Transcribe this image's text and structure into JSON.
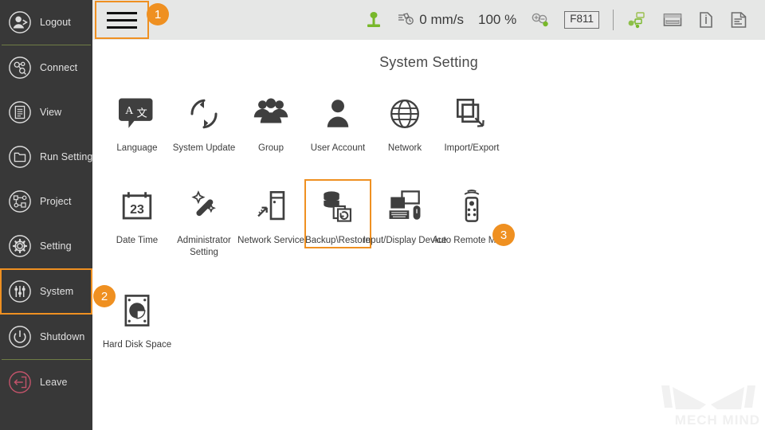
{
  "sidebar": {
    "items": [
      {
        "label": "Logout",
        "icon": "logout-user-icon",
        "sep_after": true,
        "highlight": false
      },
      {
        "label": "Connect",
        "icon": "connect-icon",
        "sep_after": false,
        "highlight": false
      },
      {
        "label": "View",
        "icon": "view-list-icon",
        "sep_after": false,
        "highlight": false
      },
      {
        "label": "Run Setting",
        "icon": "run-setting-icon",
        "sep_after": false,
        "highlight": false
      },
      {
        "label": "Project",
        "icon": "project-node-icon",
        "sep_after": false,
        "highlight": false
      },
      {
        "label": "Setting",
        "icon": "gear-icon",
        "sep_after": false,
        "highlight": false
      },
      {
        "label": "System",
        "icon": "sliders-icon",
        "sep_after": false,
        "highlight": true
      },
      {
        "label": "Shutdown",
        "icon": "power-icon",
        "sep_after": true,
        "highlight": false
      },
      {
        "label": "Leave",
        "icon": "leave-exit-icon",
        "sep_after": false,
        "highlight": false
      }
    ]
  },
  "topbar": {
    "menu_button": {
      "name": "hamburger-menu-button",
      "highlighted": true
    },
    "items": [
      {
        "type": "icon",
        "name": "robot-jog-icon",
        "text": ""
      },
      {
        "type": "text",
        "name": "speed-indicator",
        "text": "0 mm/s",
        "icon": "speed-icon"
      },
      {
        "type": "text",
        "name": "override-indicator",
        "text": "100 %"
      },
      {
        "type": "icon",
        "name": "zoom-plus-minus-icon",
        "text": ""
      },
      {
        "type": "box",
        "name": "frame-indicator",
        "text": "F811"
      },
      {
        "type": "divider",
        "name": "toolbar-divider",
        "text": ""
      },
      {
        "type": "icon",
        "name": "network-status-icon",
        "text": ""
      },
      {
        "type": "icon",
        "name": "keyboard-icon",
        "text": ""
      },
      {
        "type": "icon",
        "name": "info-icon",
        "text": ""
      },
      {
        "type": "icon",
        "name": "log-document-icon",
        "text": ""
      }
    ]
  },
  "main": {
    "title": "System Setting",
    "rows": [
      [
        {
          "label": "Language",
          "icon": "language-translate-icon",
          "selected": false,
          "wrap": false
        },
        {
          "label": "System Update",
          "icon": "system-update-icon",
          "selected": false,
          "wrap": false
        },
        {
          "label": "Group",
          "icon": "group-users-icon",
          "selected": false,
          "wrap": false
        },
        {
          "label": "User Account",
          "icon": "user-account-icon",
          "selected": false,
          "wrap": false
        },
        {
          "label": "Network",
          "icon": "network-globe-icon",
          "selected": false,
          "wrap": false
        },
        {
          "label": "Import/Export",
          "icon": "import-export-icon",
          "selected": false,
          "wrap": false
        }
      ],
      [
        {
          "label": "Date Time",
          "icon": "calendar-23-icon",
          "selected": false,
          "wrap": false
        },
        {
          "label": "Administrator Setting",
          "icon": "magic-wand-icon",
          "selected": false,
          "wrap": true
        },
        {
          "label": "Network Service",
          "icon": "network-service-icon",
          "selected": false,
          "wrap": false
        },
        {
          "label": "Backup\\Restore",
          "icon": "backup-restore-icon",
          "selected": true,
          "wrap": false
        },
        {
          "label": "Input/Display Device",
          "icon": "input-display-icon",
          "selected": false,
          "wrap": false
        },
        {
          "label": "Auto Remote Mode",
          "icon": "remote-control-icon",
          "selected": false,
          "wrap": false
        }
      ],
      [
        {
          "label": "Hard Disk Space",
          "icon": "hard-disk-space-icon",
          "selected": false,
          "wrap": false
        }
      ]
    ]
  },
  "badges": [
    {
      "id": "1",
      "label": "1",
      "target": "hamburger-menu-button"
    },
    {
      "id": "2",
      "label": "2",
      "target": "sidebar-item-system"
    },
    {
      "id": "3",
      "label": "3",
      "target": "backup-restore-tile"
    }
  ],
  "watermark": {
    "text": "MECH MIND",
    "logo": "mech-mind-logo"
  },
  "colors": {
    "accent_orange": "#ef9021",
    "sidebar_bg": "#383838",
    "topbar_bg": "#e6e7e6",
    "separator_green": "#6f7d46",
    "leave_red": "#c2536a",
    "icon_dark": "#3f3f3f",
    "status_green": "#78b82a"
  }
}
